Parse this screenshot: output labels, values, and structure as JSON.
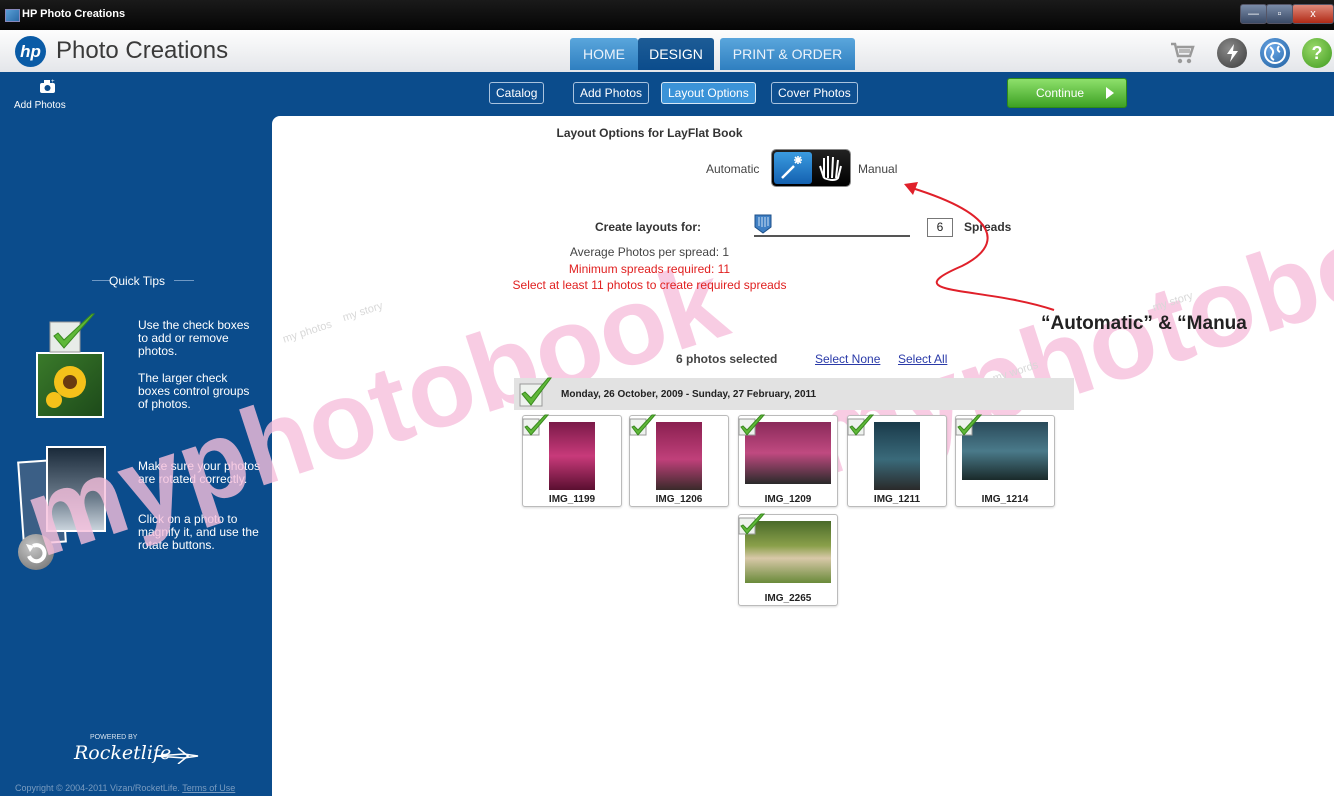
{
  "window": {
    "title": "HP Photo Creations",
    "minimize": "—",
    "maximize": "▫",
    "close": "x"
  },
  "header": {
    "logo_text": "hp",
    "app_name": "Photo Creations",
    "tabs": [
      {
        "label": "HOME"
      },
      {
        "label": "DESIGN"
      },
      {
        "label": "PRINT & ORDER"
      }
    ]
  },
  "toolbar": {
    "add_photos": "Add Photos",
    "subtabs": [
      {
        "label": "Catalog"
      },
      {
        "label": "Add Photos"
      },
      {
        "label": "Layout Options"
      },
      {
        "label": "Cover Photos"
      }
    ],
    "continue": "Continue"
  },
  "sidebar": {
    "quick_tips": "Quick Tips",
    "tips": [
      "Use the check boxes to add or remove photos.",
      "The larger check boxes control groups of photos.",
      "Make sure your photos are rotated correctly.",
      "Click on a photo to magnify it, and use the rotate buttons."
    ],
    "powered_by": "POWERED BY",
    "brand": "Rocketlife",
    "copyright": "Copyright © 2004-2011 Vizan/RocketLife.",
    "terms": "Terms of Use"
  },
  "layout": {
    "heading": "Layout Options for LayFlat Book",
    "automatic": "Automatic",
    "manual": "Manual",
    "create_for": "Create layouts for:",
    "spreads_value": "6",
    "spreads_label": "Spreads",
    "avg": "Average Photos per spread: 1",
    "min": "Minimum spreads required: 11",
    "select_msg": "Select at least 11 photos to create required spreads"
  },
  "annotation": "“Automatic” & “Manua",
  "selection": {
    "count": "6 photos selected",
    "select_none": "Select None",
    "select_all": "Select All"
  },
  "group": {
    "date_range": "Monday, 26 October, 2009 - Sunday, 27 February, 2011"
  },
  "photos": [
    {
      "name": "IMG_1199"
    },
    {
      "name": "IMG_1206"
    },
    {
      "name": "IMG_1209"
    },
    {
      "name": "IMG_1211"
    },
    {
      "name": "IMG_1214"
    },
    {
      "name": "IMG_2265"
    }
  ],
  "watermark": {
    "brand": "myphotobook",
    "tag1": "my story",
    "tag2": "my photos",
    "tag3": "my words"
  },
  "colors": {
    "brand_blue": "#0b4c8c",
    "accent_blue": "#3b93d8",
    "continue_green": "#5cc23a",
    "warning_red": "#e02020",
    "annotation_red": "#e0202a",
    "check_green": "#5fb838"
  }
}
